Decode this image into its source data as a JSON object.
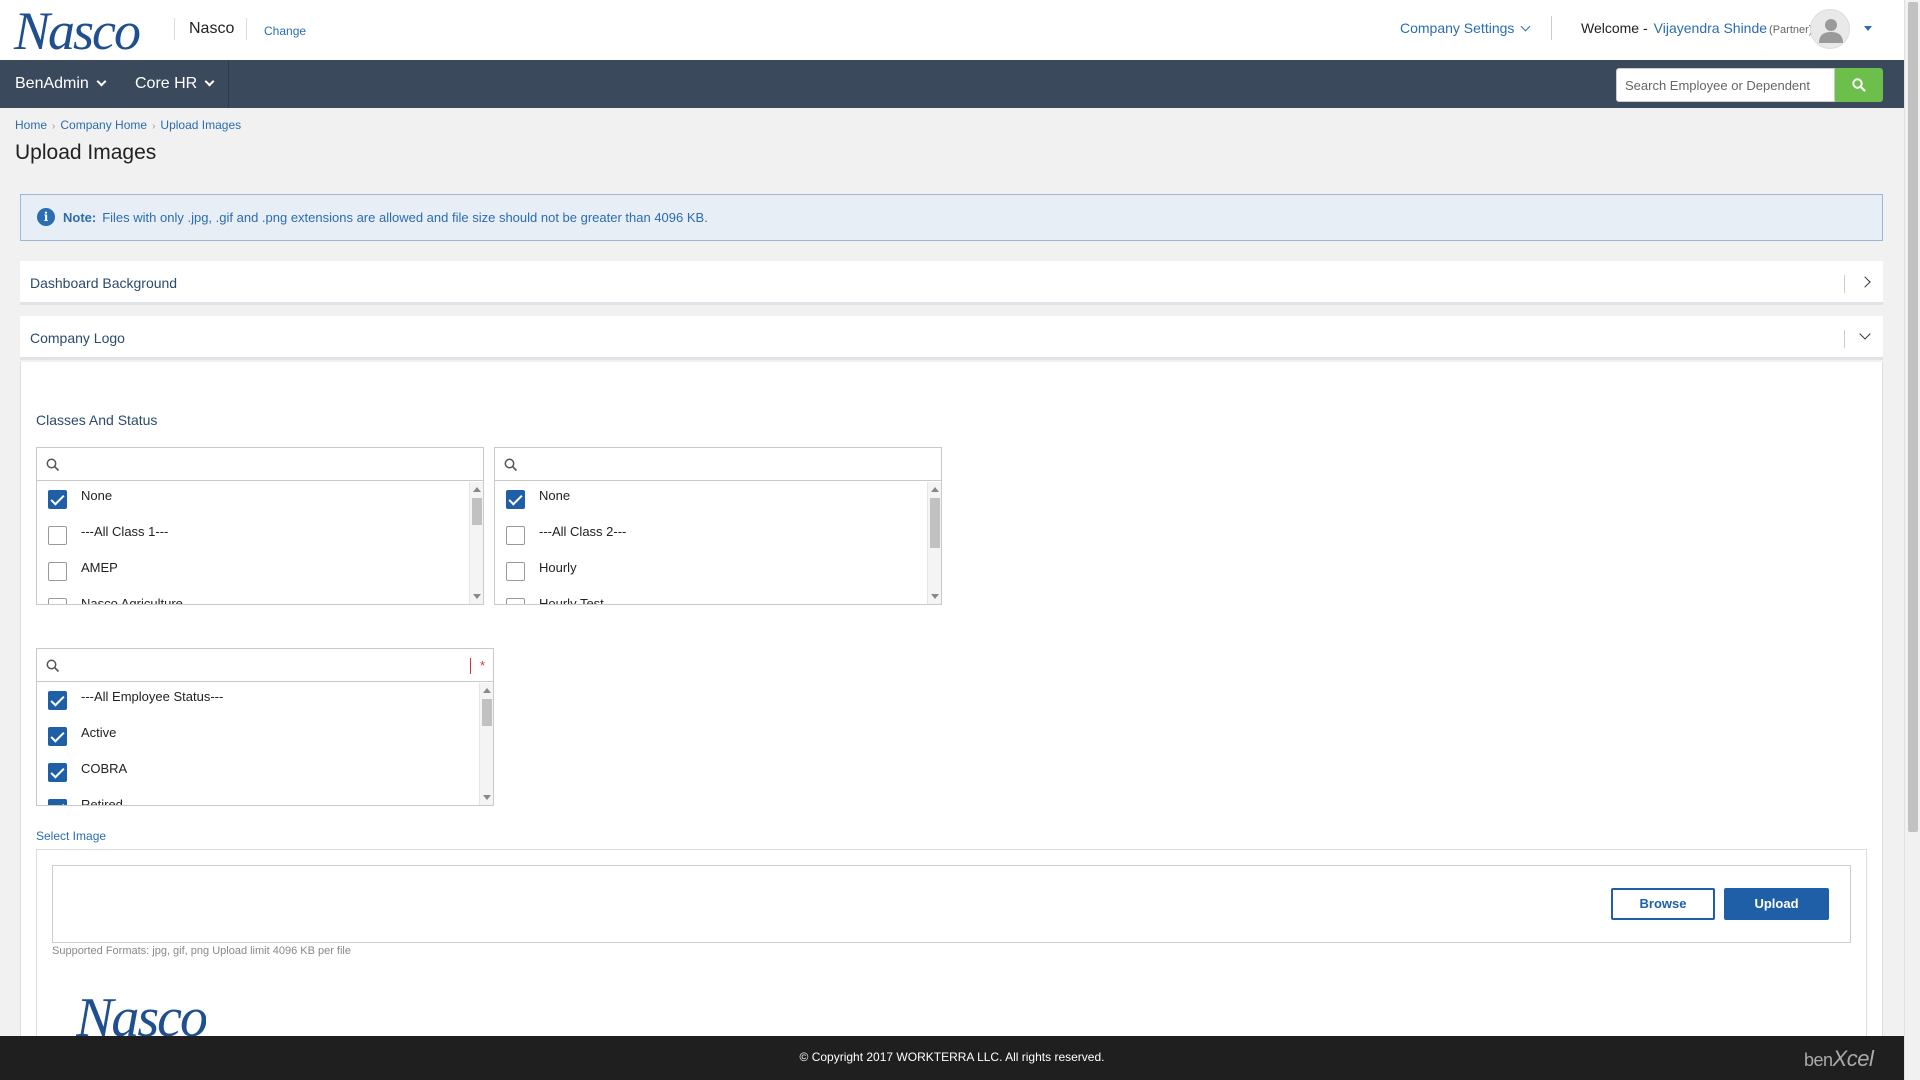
{
  "header": {
    "logo_text": "Nasco",
    "company_name": "Nasco",
    "change_label": "Change",
    "company_settings_label": "Company Settings",
    "welcome_prefix": "Welcome -",
    "user_name": "Vijayendra Shinde",
    "user_role": "(Partner)"
  },
  "nav": {
    "items": [
      {
        "label": "BenAdmin"
      },
      {
        "label": "Core HR"
      }
    ],
    "search_placeholder": "Search Employee or Dependent"
  },
  "breadcrumb": [
    "Home",
    "Company Home",
    "Upload Images"
  ],
  "page_title": "Upload Images",
  "note": {
    "label": "Note:",
    "text": "Files with only .jpg, .gif and .png extensions are allowed and file size should not be greater than 4096 KB."
  },
  "accordions": [
    {
      "title": "Dashboard Background",
      "state": "collapsed"
    },
    {
      "title": "Company Logo",
      "state": "expanded"
    }
  ],
  "classes_section": {
    "label": "Classes And Status",
    "class1_list": [
      {
        "label": "None",
        "checked": true
      },
      {
        "label": "---All Class 1---",
        "checked": false
      },
      {
        "label": "AMEP",
        "checked": false
      },
      {
        "label": "Nasco Agriculture",
        "checked": false
      }
    ],
    "class2_list": [
      {
        "label": "None",
        "checked": true
      },
      {
        "label": "---All Class 2---",
        "checked": false
      },
      {
        "label": "Hourly",
        "checked": false
      },
      {
        "label": "Hourly Test",
        "checked": false
      }
    ],
    "status_list": [
      {
        "label": "---All Employee Status---",
        "checked": true
      },
      {
        "label": "Active",
        "checked": true
      },
      {
        "label": "COBRA",
        "checked": true
      },
      {
        "label": "Retired",
        "checked": true
      }
    ],
    "required_mark": "*"
  },
  "upload": {
    "select_image_label": "Select Image",
    "browse_label": "Browse",
    "upload_label": "Upload",
    "formats_text": "Supported Formats: jpg, gif, png Upload limit 4096 KB per file",
    "preview_logo_text": "Nasco"
  },
  "footer": {
    "copyright": "© Copyright 2017 WORKTERRA LLC. All rights reserved.",
    "brand_prefix": "ben",
    "brand_suffix": "Xcel"
  },
  "colors": {
    "navbar": "#3a4a5c",
    "accent": "#1f5fa8",
    "search_button": "#6cbf4a",
    "footer": "#1f1f1f"
  }
}
